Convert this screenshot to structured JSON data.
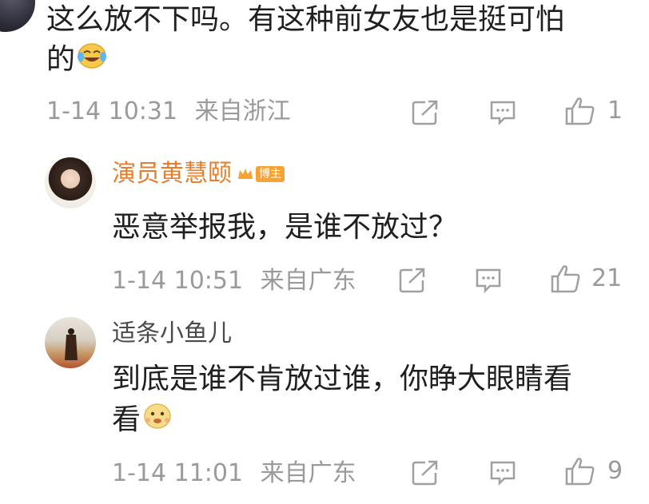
{
  "comments": [
    {
      "text_line1": "这么放不下吗。有这种前女友也是挺可怕",
      "text_line2": "的",
      "emoji": "laugh-cry-emoji",
      "time": "1-14 10:31",
      "location": "来自浙江",
      "likes": "1"
    },
    {
      "author": "演员黄慧颐",
      "badge": "博主",
      "text": "恶意举报我，是谁不放过？",
      "time": "1-14 10:51",
      "location": "来自广东",
      "likes": "21"
    },
    {
      "author": "适条小鱼儿",
      "text_line1": "到底是谁不肯放过谁，你睁大眼睛看",
      "text_line2": "看",
      "emoji": "tease-emoji",
      "time": "1-14 11:01",
      "location": "来自广东",
      "likes": "9"
    }
  ],
  "icons": {
    "share": "share-icon",
    "comment": "comment-icon",
    "like": "thumbs-up-icon"
  },
  "colors": {
    "author_highlight": "#e87d2b",
    "meta_gray": "#9a9a9a",
    "badge_orange": "#f6a334"
  }
}
